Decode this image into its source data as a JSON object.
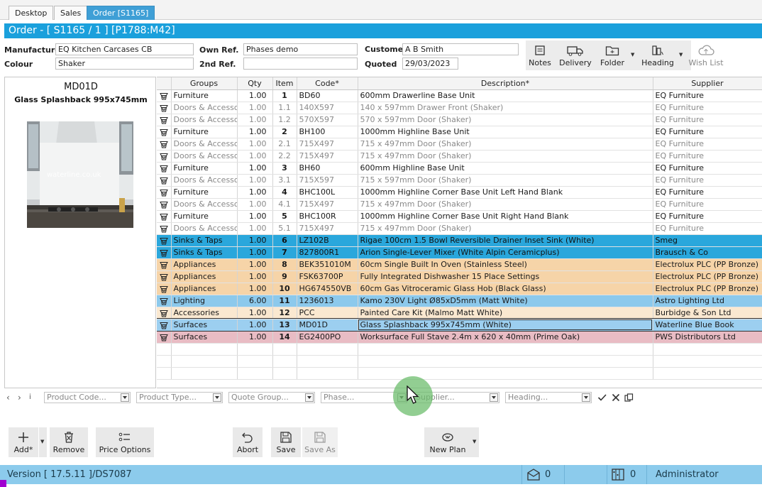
{
  "tabs": [
    {
      "label": "Desktop",
      "active": false
    },
    {
      "label": "Sales",
      "active": false
    },
    {
      "label": "Order [S1165]",
      "active": true
    }
  ],
  "title": "Order - [ S1165 / 1 ]   [P1788:M42]",
  "header": {
    "manufacturer_label": "Manufacturer",
    "manufacturer": "EQ Kitchen Carcases CB",
    "colour_label": "Colour",
    "colour": "Shaker",
    "own_ref_label": "Own Ref.",
    "own_ref": "Phases demo",
    "second_ref_label": "2nd Ref.",
    "second_ref": "",
    "customer_label": "Customer",
    "customer": "A B Smith",
    "quoted_label": "Quoted",
    "quoted": "29/03/2023"
  },
  "toolbar": {
    "notes": "Notes",
    "delivery": "Delivery",
    "folder": "Folder",
    "heading": "Heading",
    "wish_list": "Wish List"
  },
  "preview": {
    "code": "MD01D",
    "description": "Glass Splashback 995x745mm",
    "watermark": "waterline.co.uk"
  },
  "grid": {
    "columns": [
      "Groups",
      "Qty",
      "Item",
      "Code*",
      "Description*",
      "Supplier"
    ],
    "rows": [
      {
        "group": "Furniture",
        "qty": "1.00",
        "item": "1",
        "code": "BD60",
        "desc": "600mm Drawerline Base Unit",
        "supplier": "EQ Furniture",
        "style": "main"
      },
      {
        "group": "Doors & Accessor",
        "qty": "1.00",
        "item": "1.1",
        "code": "140X597",
        "desc": "140 x 597mm Drawer Front (Shaker)",
        "supplier": "EQ Furniture",
        "style": "sub"
      },
      {
        "group": "Doors & Accessor",
        "qty": "1.00",
        "item": "1.2",
        "code": "570X597",
        "desc": "570 x 597mm Door (Shaker)",
        "supplier": "EQ Furniture",
        "style": "sub"
      },
      {
        "group": "Furniture",
        "qty": "1.00",
        "item": "2",
        "code": "BH100",
        "desc": "1000mm Highline Base Unit",
        "supplier": "EQ Furniture",
        "style": "main"
      },
      {
        "group": "Doors & Accessor",
        "qty": "1.00",
        "item": "2.1",
        "code": "715X497",
        "desc": "715 x 497mm Door (Shaker)",
        "supplier": "EQ Furniture",
        "style": "sub"
      },
      {
        "group": "Doors & Accessor",
        "qty": "1.00",
        "item": "2.2",
        "code": "715X497",
        "desc": "715 x 497mm Door (Shaker)",
        "supplier": "EQ Furniture",
        "style": "sub"
      },
      {
        "group": "Furniture",
        "qty": "1.00",
        "item": "3",
        "code": "BH60",
        "desc": "600mm Highline Base Unit",
        "supplier": "EQ Furniture",
        "style": "main"
      },
      {
        "group": "Doors & Accessor",
        "qty": "1.00",
        "item": "3.1",
        "code": "715X597",
        "desc": "715 x 597mm Door (Shaker)",
        "supplier": "EQ Furniture",
        "style": "sub"
      },
      {
        "group": "Furniture",
        "qty": "1.00",
        "item": "4",
        "code": "BHC100L",
        "desc": "1000mm Highline Corner Base Unit Left Hand Blank",
        "supplier": "EQ Furniture",
        "style": "main"
      },
      {
        "group": "Doors & Accessor",
        "qty": "1.00",
        "item": "4.1",
        "code": "715X497",
        "desc": "715 x 497mm Door (Shaker)",
        "supplier": "EQ Furniture",
        "style": "sub"
      },
      {
        "group": "Furniture",
        "qty": "1.00",
        "item": "5",
        "code": "BHC100R",
        "desc": "1000mm Highline Corner Base Unit Right Hand Blank",
        "supplier": "EQ Furniture",
        "style": "main"
      },
      {
        "group": "Doors & Accessor",
        "qty": "1.00",
        "item": "5.1",
        "code": "715X497",
        "desc": "715 x 497mm Door (Shaker)",
        "supplier": "EQ Furniture",
        "style": "sub"
      },
      {
        "group": "Sinks & Taps",
        "qty": "1.00",
        "item": "6",
        "code": "LZ102B",
        "desc": "Rigae 100cm 1.5 Bowl Reversible Drainer Inset Sink (White)",
        "supplier": "Smeg",
        "style": "main blue"
      },
      {
        "group": "Sinks & Taps",
        "qty": "1.00",
        "item": "7",
        "code": "827800R1",
        "desc": "Arion Single-Lever Mixer (White Alpin Ceramicplus)",
        "supplier": "Brausch & Co",
        "style": "main blue"
      },
      {
        "group": "Appliances",
        "qty": "1.00",
        "item": "8",
        "code": "BEK351010M",
        "desc": "60cm Single Built In Oven (Stainless Steel)",
        "supplier": "Electrolux PLC (PP Bronze)",
        "style": "main peach"
      },
      {
        "group": "Appliances",
        "qty": "1.00",
        "item": "9",
        "code": "FSK63700P",
        "desc": "Fully Integrated Dishwasher 15 Place Settings",
        "supplier": "Electrolux PLC (PP Bronze)",
        "style": "main peach"
      },
      {
        "group": "Appliances",
        "qty": "1.00",
        "item": "10",
        "code": "HG674550VB",
        "desc": "60cm Gas Vitroceramic Glass Hob (Black Glass)",
        "supplier": "Electrolux PLC (PP Bronze)",
        "style": "main peach"
      },
      {
        "group": "Lighting",
        "qty": "6.00",
        "item": "11",
        "code": "1236013",
        "desc": "Kamo 230V Light Ø85xD5mm (Matt White)",
        "supplier": "Astro Lighting Ltd",
        "style": "main lblue"
      },
      {
        "group": "Accessories",
        "qty": "1.00",
        "item": "12",
        "code": "PCC",
        "desc": "Painted Care Kit (Malmo Matt White)",
        "supplier": "Burbidge & Son Ltd",
        "style": "main cream"
      },
      {
        "group": "Surfaces",
        "qty": "1.00",
        "item": "13",
        "code": "MD01D",
        "desc": "Glass Splashback 995x745mm (White)",
        "supplier": "Waterline Blue Book",
        "style": "main sel"
      },
      {
        "group": "Surfaces",
        "qty": "1.00",
        "item": "14",
        "code": "EG2400PO",
        "desc": "Worksurface Full Stave 2.4m x 620 x 40mm (Prime Oak)",
        "supplier": "PWS Distributors Ltd",
        "style": "main pink"
      }
    ]
  },
  "filters": {
    "product_code": "Product Code...",
    "product_type": "Product Type...",
    "quote_group": "Quote Group...",
    "phase": "Phase...",
    "supplier": "Supplier...",
    "heading": "Heading..."
  },
  "actions": {
    "add": "Add*",
    "remove": "Remove",
    "price_options": "Price Options",
    "abort": "Abort",
    "save": "Save",
    "save_as": "Save As",
    "new_plan": "New Plan"
  },
  "status": {
    "version": "Version [ 17.5.11 ]/DS7087",
    "messages_count": "0",
    "tasks_count": "0",
    "user": "Administrator"
  }
}
